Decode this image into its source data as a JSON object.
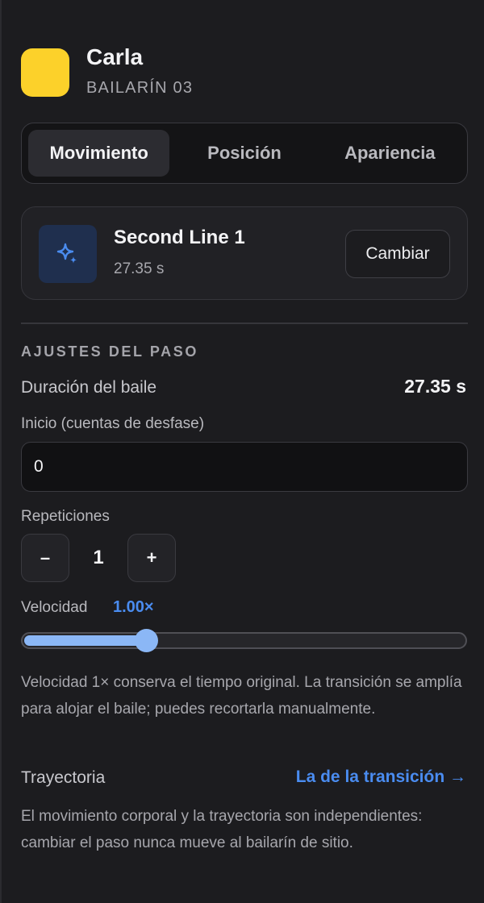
{
  "dancer": {
    "name": "Carla",
    "code": "BAILARÍN 03",
    "color": "#fcd12a"
  },
  "tabs": [
    {
      "label": "Movimiento",
      "active": true
    },
    {
      "label": "Posición",
      "active": false
    },
    {
      "label": "Apariencia",
      "active": false
    }
  ],
  "step": {
    "icon": "sparkles-icon",
    "title": "Second Line 1",
    "duration": "27.35 s",
    "change_label": "Cambiar"
  },
  "settings": {
    "section_title": "AJUSTES DEL PASO",
    "duration_label": "Duración del baile",
    "duration_value": "27.35 s",
    "start_label": "Inicio (cuentas de desfase)",
    "start_value": "0",
    "repetitions_label": "Repeticiones",
    "repetitions_value": "1",
    "minus_label": "–",
    "plus_label": "+",
    "speed_label": "Velocidad",
    "speed_value": "1.00×",
    "speed_fraction": 0.28,
    "speed_note": "Velocidad 1× conserva el tiempo original. La transición se amplía para alojar el baile; puedes recortarla manualmente.",
    "trajectory_label": "Trayectoria",
    "trajectory_link": "La de la transición →",
    "trajectory_note": "El movimiento corporal y la trayectoria son independientes: cambiar el paso nunca mueve al bailarín de sitio."
  },
  "colors": {
    "accent": "#4a8cf0",
    "slider_fill": "#8bb7f6",
    "background": "#1c1c1f"
  }
}
